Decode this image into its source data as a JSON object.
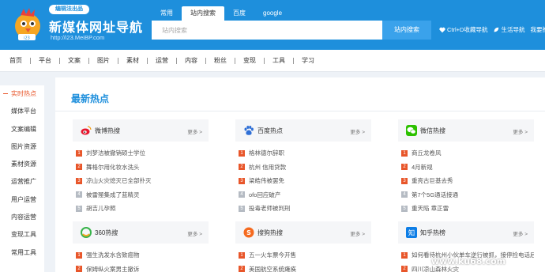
{
  "header": {
    "badge": "编辑法出品",
    "logo_title": "新媒体网址导航",
    "logo_url": "http://i23.MeiBP.com",
    "links": [
      {
        "icon": "heart-icon",
        "label": "Ctrl+D收藏导航"
      },
      {
        "icon": "leaf-icon",
        "label": "生活导航"
      },
      {
        "icon": "",
        "label": "我要推"
      }
    ]
  },
  "search": {
    "tabs": [
      "常用",
      "站内搜索",
      "百度",
      "google"
    ],
    "active_tab": 1,
    "placeholder": "站内搜索",
    "button": "站内搜索"
  },
  "nav": {
    "items": [
      "首页",
      "平台",
      "文案",
      "图片",
      "素材",
      "运营",
      "内容",
      "粉丝",
      "变现",
      "工具",
      "学习"
    ]
  },
  "sidebar": {
    "items": [
      "实时热点",
      "媒体平台",
      "文案编辑",
      "图片资源",
      "素材资源",
      "运营推广",
      "用户运营",
      "内容运营",
      "变现工具",
      "常用工具"
    ],
    "active": 0
  },
  "main": {
    "title": "最新热点",
    "more": "更多 >",
    "cards": [
      {
        "title": "微博热搜",
        "icon": "weibo-icon",
        "rows": [
          "刘梦洁被撤销硕士学位",
          "舞格尔用化妆水洗头",
          "凉山火灾熄灭已全部扑灭",
          "被雷殛集成了蓝精灵",
          "胡吉儿孕照"
        ]
      },
      {
        "title": "百度热点",
        "icon": "baidu-paw-icon",
        "rows": [
          "格林德尔辞职",
          "杭州 信用贷款",
          "梁皓伟被罢免",
          "ofo回应破产",
          "投毒老师被判刑"
        ]
      },
      {
        "title": "微信热搜",
        "icon": "wechat-icon",
        "rows": [
          "商丘龙卷风",
          "4月新规",
          "重亮古巨基去秀",
          "第7个5G通话接通",
          "重天陷 章正雷"
        ]
      },
      {
        "title": "360热搜",
        "icon": "360-icon",
        "rows": [
          "强生洗发水含致癌物",
          "保姆纵火案男主撤诉"
        ]
      },
      {
        "title": "搜狗热搜",
        "icon": "sogou-icon",
        "rows": [
          "五一火车票今开售",
          "美国航空系统瘫痪"
        ]
      },
      {
        "title": "知乎热榜",
        "icon": "zhihu-icon",
        "rows": [
          "如何看待杭州小伙单车逆行被抓，接停捡电话后崩溃",
          "四川凉山森林火灾"
        ]
      }
    ]
  },
  "watermark": "www.ku68.com",
  "colors": {
    "header_bg": "#1e8fdc",
    "accent": "#e8562a",
    "title_blue": "#1e8fdc"
  }
}
